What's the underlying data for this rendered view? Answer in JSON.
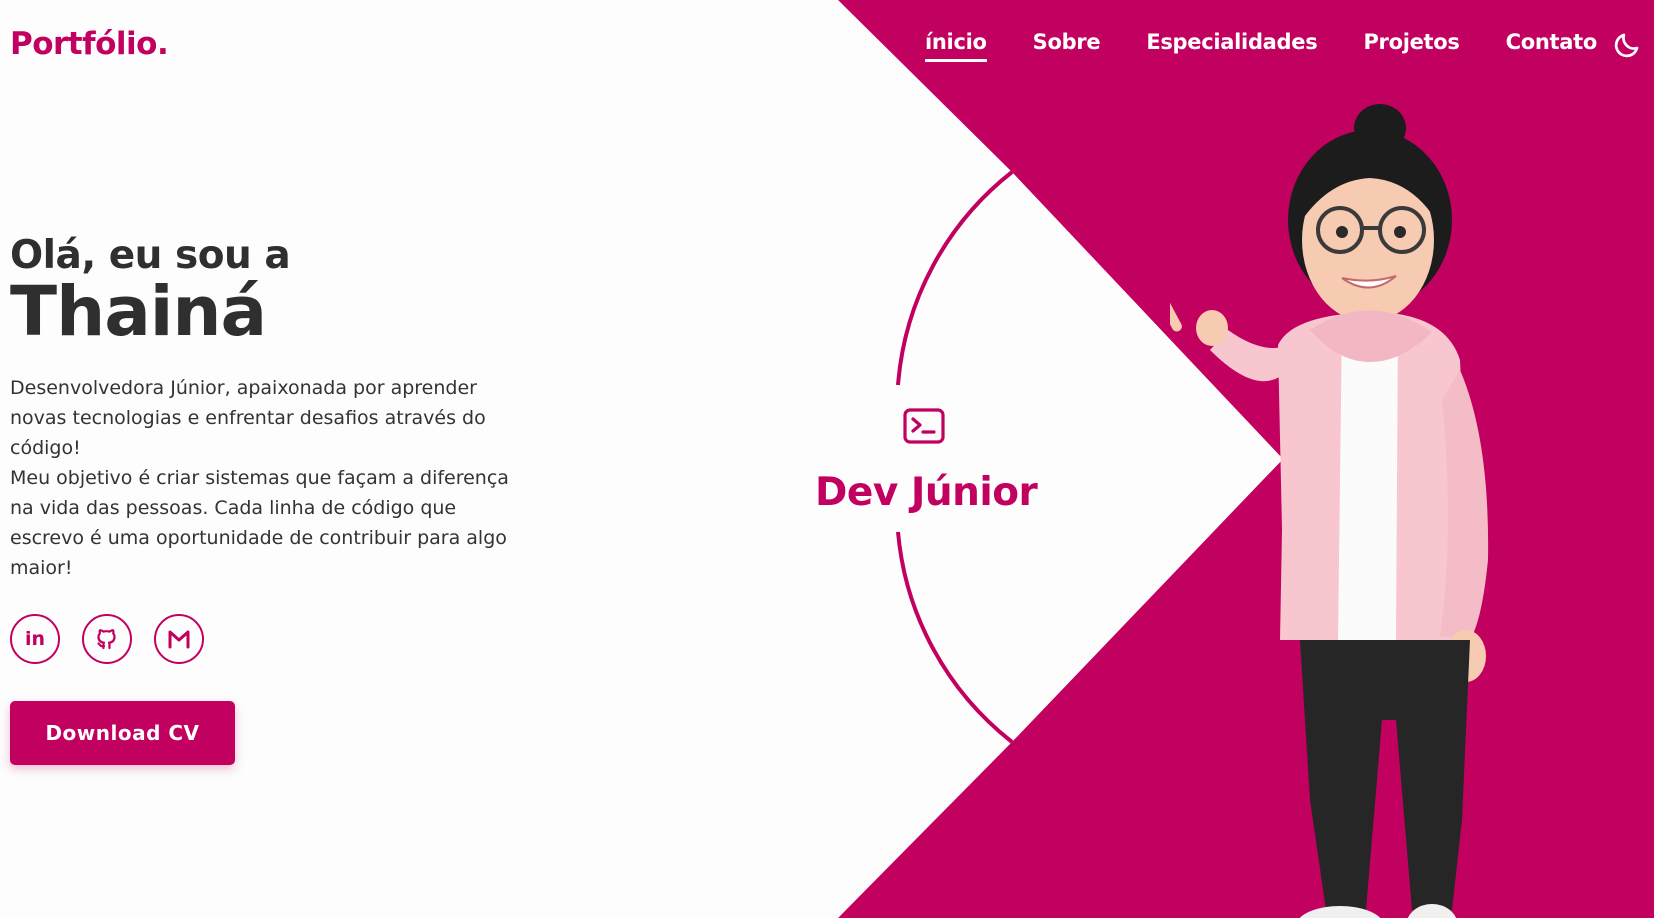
{
  "header": {
    "logo": "Portfólio.",
    "nav": [
      "ínicio",
      "Sobre",
      "Especialidades",
      "Projetos",
      "Contato"
    ],
    "active_nav": "ínicio",
    "theme_toggle_icon": "moon-icon"
  },
  "hero": {
    "greeting": "Olá, eu sou a",
    "name": "Thainá",
    "description_lines": [
      "Desenvolvedora Júnior, apaixonada por aprender",
      "novas tecnologias e enfrentar desafios através do",
      "código!",
      "Meu objetivo é criar sistemas que façam a diferença",
      "na vida das pessoas. Cada linha de código que",
      "escrevo é uma oportunidade de contribuir para algo",
      "maior!"
    ],
    "socials": [
      {
        "icon": "linkedin-icon",
        "text": "in"
      },
      {
        "icon": "github-icon"
      },
      {
        "icon": "gmail-icon"
      }
    ],
    "cv_button": "Download CV"
  },
  "badge": {
    "icon": "terminal-icon",
    "label": "Dev Júnior"
  },
  "colors": {
    "accent": "#c2005f",
    "background": "#fdfdfd",
    "text": "#2f2f2f"
  }
}
